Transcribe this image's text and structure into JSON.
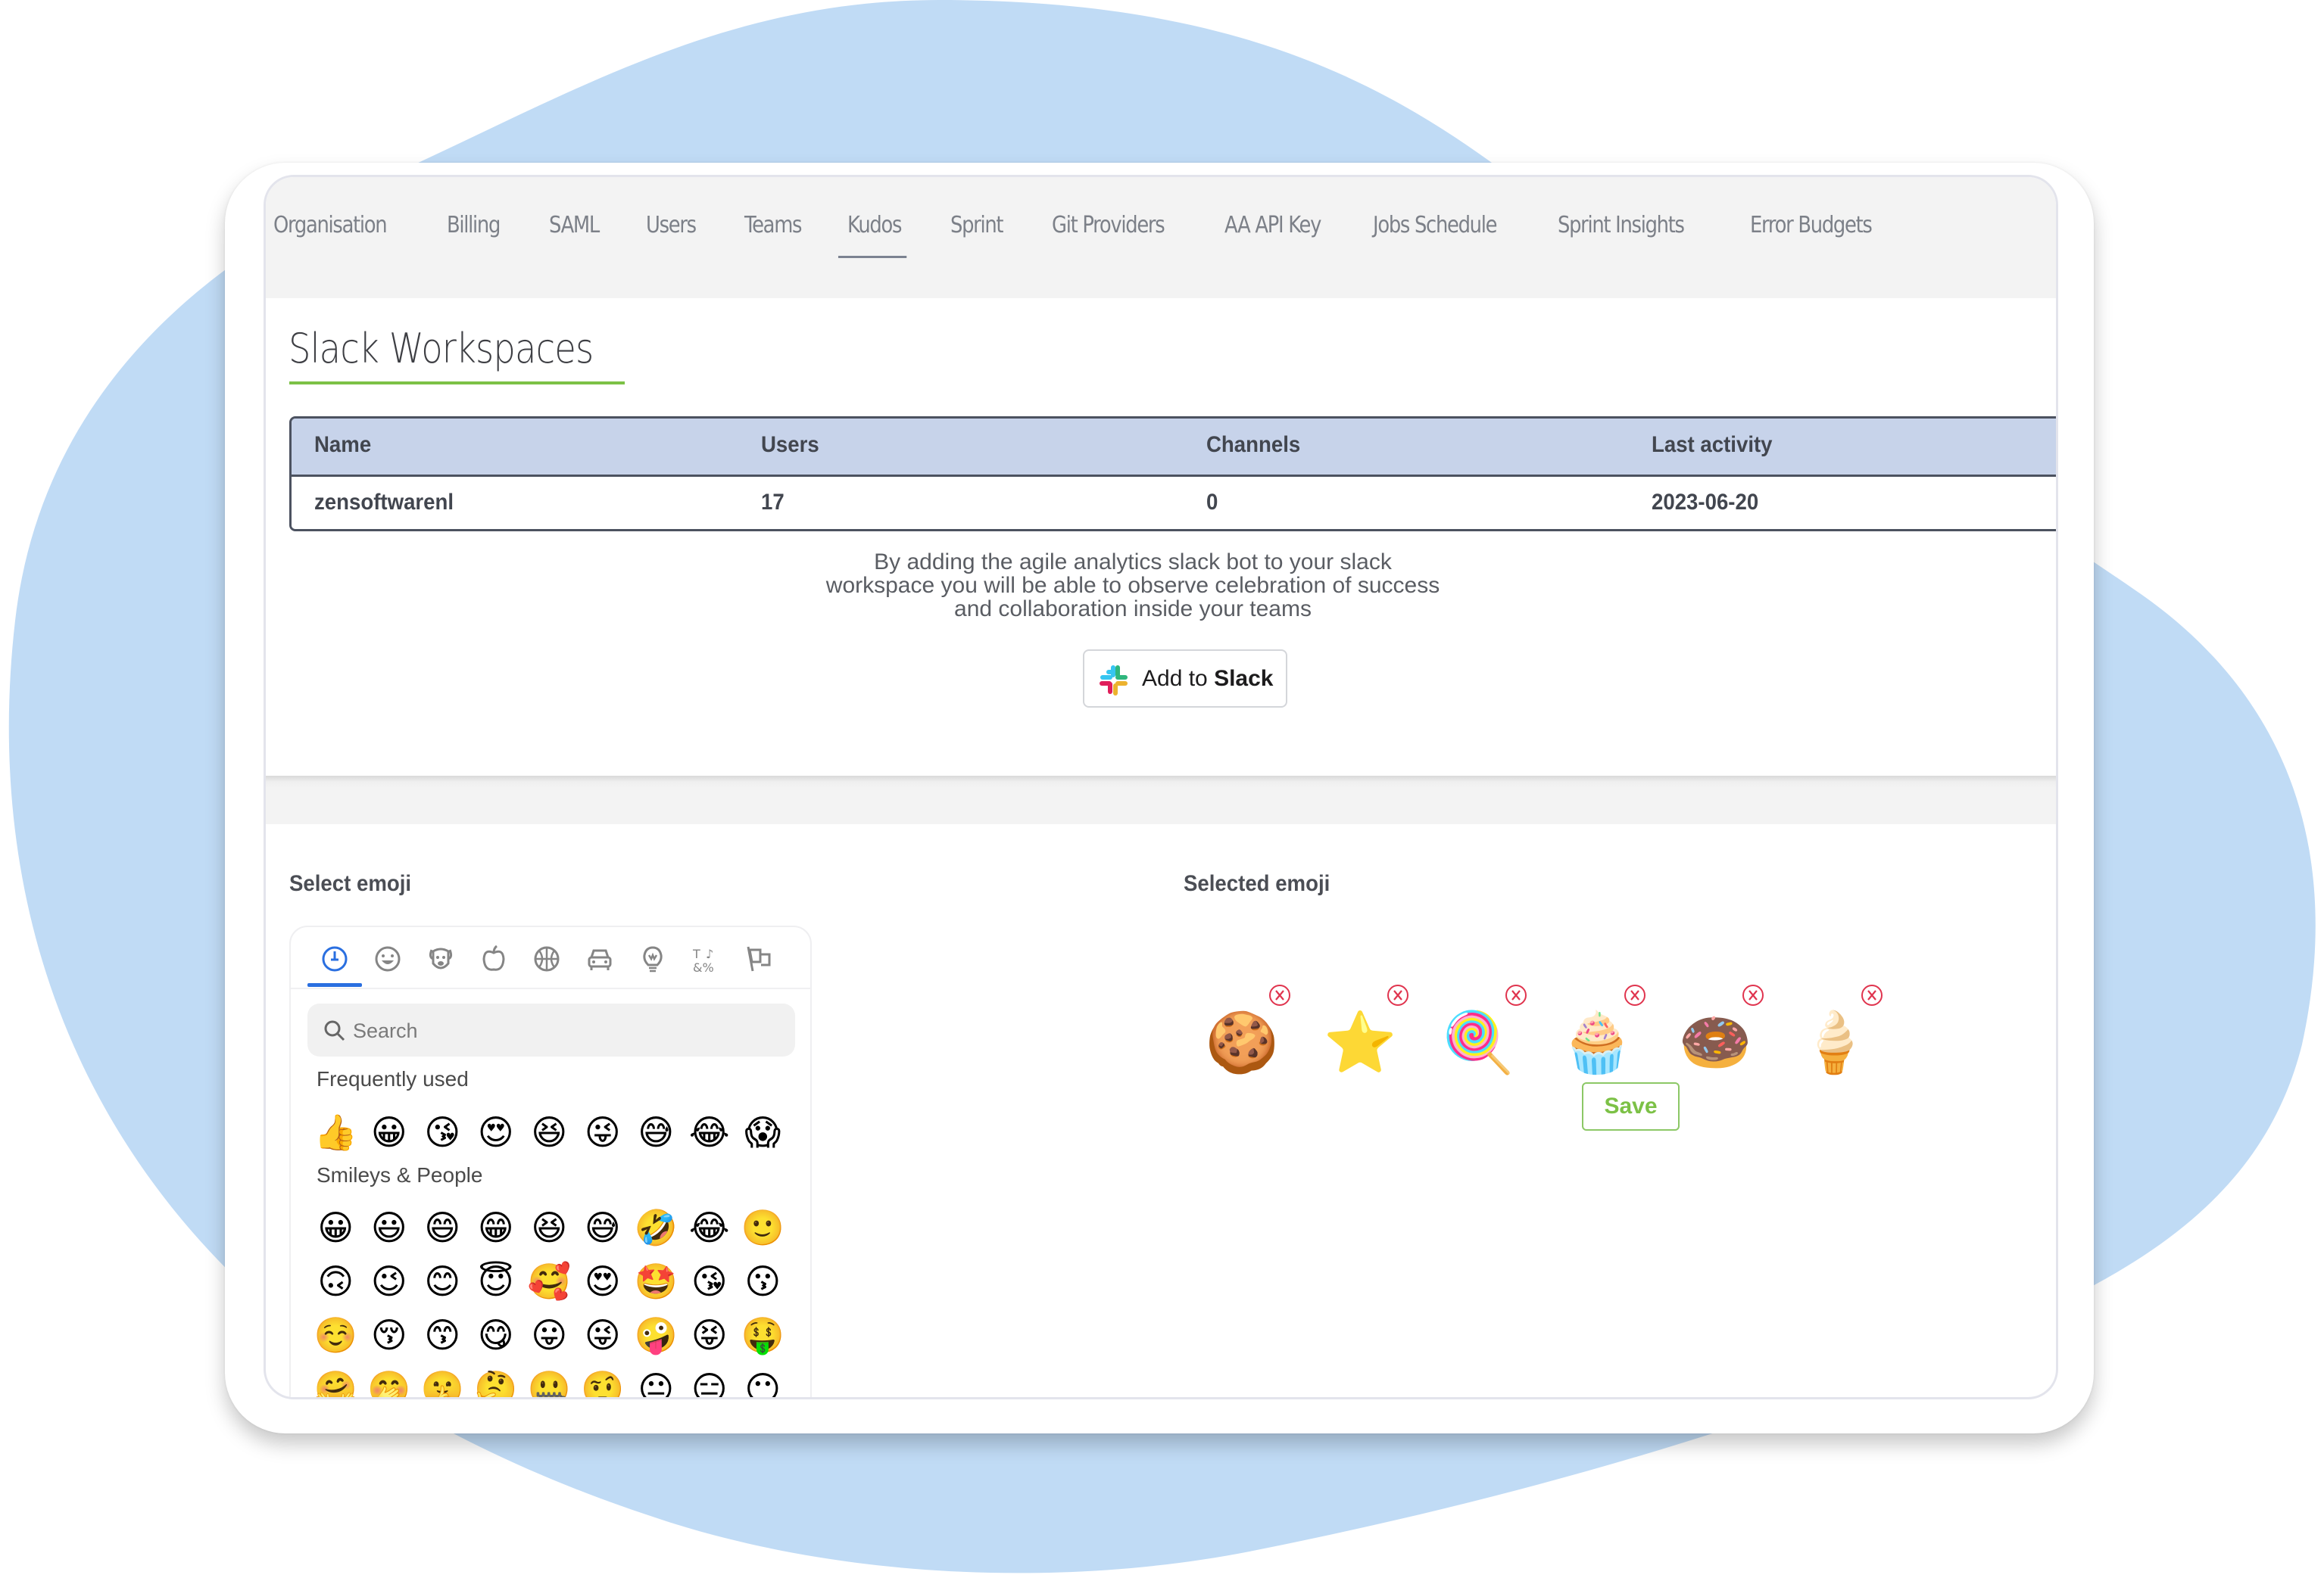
{
  "colors": {
    "background_blob": "#c0dbf5",
    "accent_green": "#7cc146",
    "table_header_bg": "#c7d3ea",
    "active_category_blue": "#2a6fe0",
    "remove_red": "#e0344e"
  },
  "tabs": [
    {
      "label": "Organisation",
      "active": false
    },
    {
      "label": "Billing",
      "active": false
    },
    {
      "label": "SAML",
      "active": false
    },
    {
      "label": "Users",
      "active": false
    },
    {
      "label": "Teams",
      "active": false
    },
    {
      "label": "Kudos",
      "active": true
    },
    {
      "label": "Sprint",
      "active": false
    },
    {
      "label": "Git Providers",
      "active": false
    },
    {
      "label": "AA API Key",
      "active": false
    },
    {
      "label": "Jobs Schedule",
      "active": false
    },
    {
      "label": "Sprint Insights",
      "active": false
    },
    {
      "label": "Error Budgets",
      "active": false
    }
  ],
  "slack": {
    "title": "Slack Workspaces",
    "table": {
      "columns": [
        "Name",
        "Users",
        "Channels",
        "Last activity"
      ],
      "rows": [
        {
          "name": "zensoftwarenl",
          "users": "17",
          "channels": "0",
          "last_activity": "2023-06-20"
        }
      ]
    },
    "description": "By adding the agile analytics slack bot to your slack workspace you will be able to observe celebration of success and collaboration inside your teams",
    "add_button": {
      "prefix": "Add to ",
      "brand": "Slack",
      "icon": "slack-logo-icon"
    }
  },
  "emoji_picker": {
    "label": "Select emoji",
    "categories": [
      {
        "icon": "clock-icon",
        "name": "Frequently used",
        "active": true
      },
      {
        "icon": "smiley-icon",
        "name": "Smileys & People",
        "active": false
      },
      {
        "icon": "dog-icon",
        "name": "Animals & Nature",
        "active": false
      },
      {
        "icon": "apple-icon",
        "name": "Food & Drink",
        "active": false
      },
      {
        "icon": "basketball-icon",
        "name": "Activity",
        "active": false
      },
      {
        "icon": "car-icon",
        "name": "Travel & Places",
        "active": false
      },
      {
        "icon": "lightbulb-icon",
        "name": "Objects",
        "active": false
      },
      {
        "icon": "symbols-icon",
        "name": "Symbols",
        "active": false
      },
      {
        "icon": "flags-icon",
        "name": "Flags",
        "active": false
      }
    ],
    "search": {
      "placeholder": "Search",
      "value": ""
    },
    "groups": [
      {
        "label": "Frequently used",
        "rows": [
          [
            "👍",
            "😀",
            "😘",
            "😍",
            "😆",
            "😜",
            "😅",
            "😂",
            "😱"
          ]
        ]
      },
      {
        "label": "Smileys & People",
        "rows": [
          [
            "😀",
            "😃",
            "😄",
            "😁",
            "😆",
            "😅",
            "🤣",
            "😂",
            "🙂"
          ],
          [
            "🙃",
            "😉",
            "😊",
            "😇",
            "🥰",
            "😍",
            "🤩",
            "😘",
            "😗"
          ],
          [
            "☺️",
            "😚",
            "😙",
            "😋",
            "😛",
            "😜",
            "🤪",
            "😝",
            "🤑"
          ],
          [
            "🤗",
            "🤭",
            "🤫",
            "🤔",
            "🤐",
            "🤨",
            "😐",
            "😑",
            "😶"
          ]
        ]
      }
    ]
  },
  "selected_emoji": {
    "label": "Selected emoji",
    "items": [
      {
        "glyph": "🍪",
        "name": "cookie"
      },
      {
        "glyph": "⭐",
        "name": "star"
      },
      {
        "glyph": "🍭",
        "name": "lollipop"
      },
      {
        "glyph": "🧁",
        "name": "cupcake"
      },
      {
        "glyph": "🍩",
        "name": "doughnut"
      },
      {
        "glyph": "🍦",
        "name": "soft-ice-cream"
      }
    ],
    "save_label": "Save"
  }
}
